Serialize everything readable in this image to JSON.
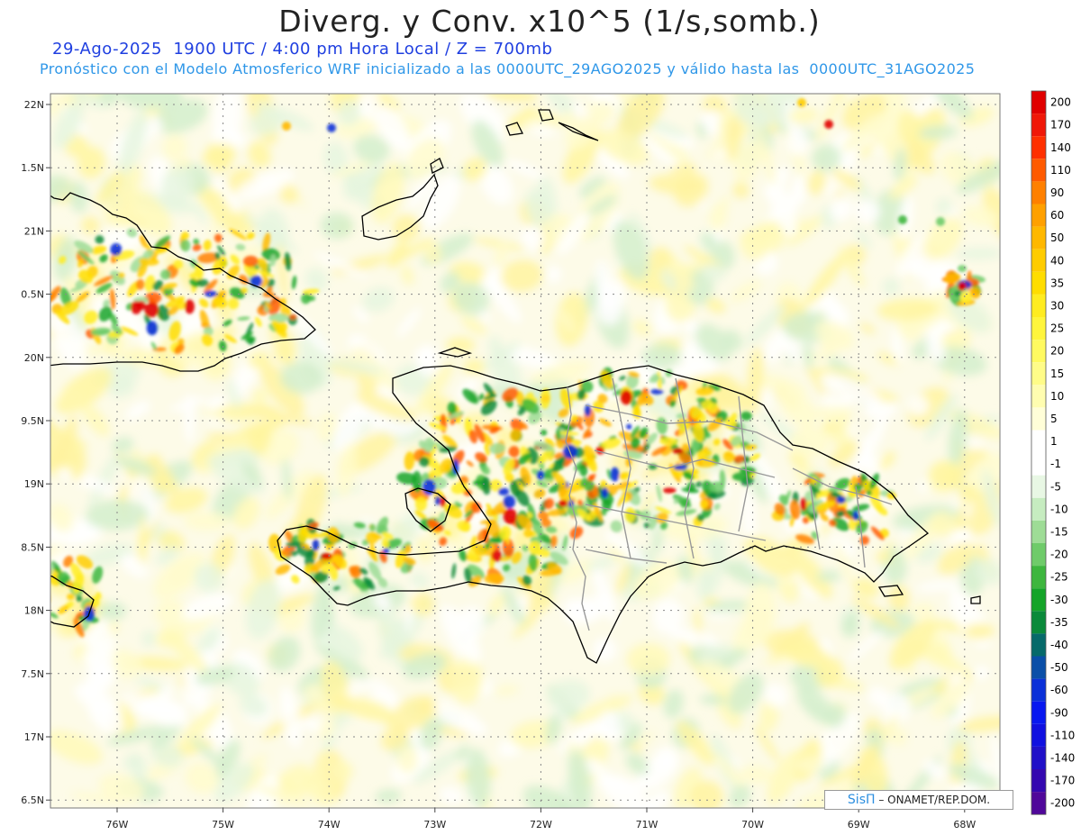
{
  "header": {
    "title": "Diverg. y Conv. x10^5 (1/s,somb.)",
    "subtitle": "29-Ago-2025  1900 UTC / 4:00 pm Hora Local / Z = 700mb",
    "description": "Pronóstico con el Modelo Atmosferico WRF inicializado a las 0000UTC_29AGO2025 y válido hasta las  0000UTC_31AGO2025"
  },
  "axes": {
    "lat_labels": [
      "22N",
      "1.5N",
      "21N",
      "0.5N",
      "20N",
      "9.5N",
      "19N",
      "8.5N",
      "18N",
      "7.5N",
      "17N",
      "6.5N"
    ],
    "lon_labels": [
      "76W",
      "75W",
      "74W",
      "73W",
      "72W",
      "71W",
      "70W",
      "69W",
      "68W"
    ]
  },
  "colorbar": {
    "labels": [
      "200",
      "170",
      "140",
      "110",
      "90",
      "60",
      "50",
      "40",
      "35",
      "30",
      "25",
      "20",
      "15",
      "10",
      "5",
      "1",
      "-1",
      "-5",
      "-10",
      "-15",
      "-20",
      "-25",
      "-30",
      "-35",
      "-40",
      "-50",
      "-60",
      "-90",
      "-110",
      "-140",
      "-170",
      "-200"
    ],
    "colors": [
      "#e00000",
      "#f01808",
      "#ff3000",
      "#ff5a00",
      "#ff8000",
      "#ffa000",
      "#ffb800",
      "#ffcc00",
      "#ffdd00",
      "#ffec20",
      "#fff53c",
      "#fffa60",
      "#fffc88",
      "#fffdb0",
      "#fffed8",
      "#ffffff",
      "#ffffff",
      "#e8f7e4",
      "#c6ecc0",
      "#9edc96",
      "#6fcb6a",
      "#3db63e",
      "#14a428",
      "#0a8a3a",
      "#066a6a",
      "#0a4fa8",
      "#0a30d8",
      "#0818f0",
      "#1010e0",
      "#2010c8",
      "#3408b0",
      "#50089a"
    ]
  },
  "credit": {
    "brand": "SisΠ",
    "text": " – ONAMET/REP.DOM."
  }
}
